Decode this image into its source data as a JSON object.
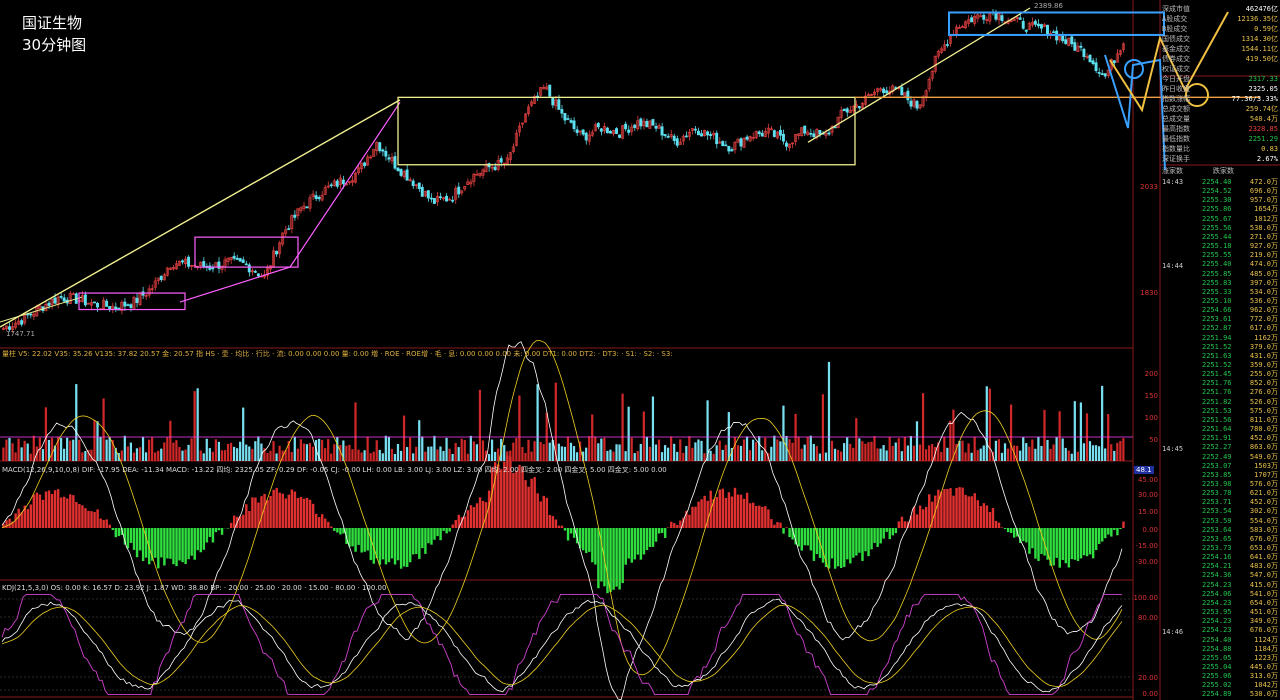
{
  "header": {
    "name": "国证生物",
    "period": "30分钟图"
  },
  "chart_data": [
    {
      "type": "candlestick",
      "title": "国证生物",
      "subtitle": "30分钟图",
      "price_labels": {
        "low": "1747.71",
        "high": "2389.86"
      },
      "axis_ticks": [
        "2033",
        "1830"
      ],
      "close_path": [
        1748,
        1765,
        1790,
        1810,
        1805,
        1795,
        1790,
        1800,
        1830,
        1880,
        1875,
        1870,
        1880,
        1875,
        1850,
        1940,
        1990,
        2020,
        2040,
        2060,
        2120,
        2075,
        2040,
        2000,
        2010,
        2050,
        2070,
        2080,
        2180,
        2230,
        2170,
        2130,
        2150,
        2140,
        2160,
        2150,
        2120,
        2150,
        2130,
        2110,
        2135,
        2140,
        2120,
        2145,
        2130,
        2180,
        2200,
        2230,
        2220,
        2190,
        2290,
        2350,
        2370,
        2380,
        2365,
        2350,
        2345,
        2320,
        2300,
        2250,
        2325
      ],
      "annotations": {
        "key_level": 2210
      }
    },
    {
      "type": "bar",
      "title": "量柱",
      "indicator_text": "量柱 V5: 22.02  V35: 35.26  V135: 37.82  20.57  金: 20.57  指  HS  ·  壶  ·  均比  ·  行比  ·  流: 0.00  0.00  0.00  量: 0.00  増  ·  ROE  ·  ROE增  ·  毛  ·  息: 0.00  0.00  0.00  未: 0.00  DT1: 0.00  DT2:  ·  DT3:  ·  S1:  ·  S2:  ·  S3:",
      "axis_ticks": [
        "200",
        "150",
        "100",
        "50"
      ]
    },
    {
      "type": "bar",
      "title": "MACD",
      "indicator_text": "MACD(12,26,9,10,0,8)  DIF: -17.95  DEA: -11.34  MACD: -13.22  四均: 2325.05  ZF: 0.29  DF: -0.05  CJ: -0.00  LH: 0.00  LB: 3.00  LJ: 3.00  LZ: 3.00  四均: 2.00  四金叉: 2.00  四金叉: 5.00  四金叉: 5.00  0.00",
      "axis_ticks": [
        "45.00",
        "30.00",
        "15.00",
        "0.00",
        "-15.00",
        "-30.00"
      ],
      "marker_value": "48.1"
    },
    {
      "type": "line",
      "title": "KDJ",
      "indicator_text": "KDJ(21,5,3,0)  OS: 0.00  K: 16.57  D: 23.92  J: 1.87  WD: 38.80  BP:  ·  20.00  ·  25.00  ·  20.00  ·  15.00  ·  80.00  ·  100.00",
      "axis_ticks": [
        "100.00",
        "80.00",
        "20.00",
        "0.00"
      ]
    }
  ],
  "side_panel": {
    "stats": [
      {
        "label": "深成市值",
        "value": "462476亿",
        "color": "#ffffff"
      },
      {
        "label": "A股成交",
        "value": "12136.35亿",
        "color": "#e8c14a"
      },
      {
        "label": "B股成交",
        "value": "0.59亿",
        "color": "#e8c14a"
      },
      {
        "label": "国债成交",
        "value": "1314.30亿",
        "color": "#e8c14a"
      },
      {
        "label": "基金成交",
        "value": "1544.11亿",
        "color": "#e8c14a"
      },
      {
        "label": "债券成交",
        "value": "419.50亿",
        "color": "#e8c14a"
      },
      {
        "label": "权证成交",
        "value": "",
        "color": "#e8c14a"
      },
      {
        "label": "今日开盘",
        "value": "2317.33",
        "color": "#22c44b"
      },
      {
        "label": "昨日收盘",
        "value": "2325.05",
        "color": "#ffffff"
      },
      {
        "label": "指数涨幅",
        "value": "77.36/3.33%",
        "color": "#ffffff"
      },
      {
        "label": "总成交额",
        "value": "259.74亿",
        "color": "#e8c14a"
      },
      {
        "label": "总成交量",
        "value": "540.4万",
        "color": "#e8c14a"
      },
      {
        "label": "最高指数",
        "value": "2328.85",
        "color": "#e84040"
      },
      {
        "label": "最低指数",
        "value": "2251.29",
        "color": "#22c44b"
      },
      {
        "label": "指数量比",
        "value": "0.83",
        "color": "#e8c14a"
      },
      {
        "label": "深证换手",
        "value": "2.67%",
        "color": "#ffffff"
      }
    ],
    "columns": {
      "left": "涨家数",
      "right": "跌家数"
    },
    "times": [
      "14:43",
      "14:44",
      "14:45",
      "14:46"
    ],
    "ticks": [
      [
        "2254.40",
        "472.0万"
      ],
      [
        "2254.52",
        "696.0万"
      ],
      [
        "2255.30",
        "957.0万"
      ],
      [
        "2255.86",
        "1654万"
      ],
      [
        "2255.67",
        "1012万"
      ],
      [
        "2255.56",
        "538.0万"
      ],
      [
        "2255.44",
        "271.0万"
      ],
      [
        "2255.18",
        "927.0万"
      ],
      [
        "2255.55",
        "219.0万"
      ],
      [
        "2255.40",
        "474.0万"
      ],
      [
        "2255.85",
        "485.0万"
      ],
      [
        "2255.83",
        "397.0万"
      ],
      [
        "2255.33",
        "534.0万"
      ],
      [
        "2255.10",
        "536.0万"
      ],
      [
        "2254.66",
        "962.0万"
      ],
      [
        "2253.61",
        "772.0万"
      ],
      [
        "2252.87",
        "617.0万"
      ],
      [
        "2251.94",
        "1162万"
      ],
      [
        "2251.52",
        "379.0万"
      ],
      [
        "2251.63",
        "431.0万"
      ],
      [
        "2251.52",
        "359.0万"
      ],
      [
        "2251.45",
        "255.0万"
      ],
      [
        "2251.76",
        "852.0万"
      ],
      [
        "2251.76",
        "276.0万"
      ],
      [
        "2251.82",
        "526.0万"
      ],
      [
        "2251.53",
        "575.0万"
      ],
      [
        "2251.56",
        "811.0万"
      ],
      [
        "2251.64",
        "780.0万"
      ],
      [
        "2251.91",
        "452.0万"
      ],
      [
        "2252.27",
        "863.0万"
      ],
      [
        "2252.49",
        "549.0万"
      ],
      [
        "2253.07",
        "1503万"
      ],
      [
        "2253.85",
        "1707万"
      ],
      [
        "2253.98",
        "576.0万"
      ],
      [
        "2253.78",
        "621.0万"
      ],
      [
        "2253.71",
        "452.0万"
      ],
      [
        "2253.54",
        "302.0万"
      ],
      [
        "2253.59",
        "554.0万"
      ],
      [
        "2253.64",
        "583.0万"
      ],
      [
        "2253.65",
        "676.0万"
      ],
      [
        "2253.73",
        "653.0万"
      ],
      [
        "2254.16",
        "641.0万"
      ],
      [
        "2254.21",
        "483.0万"
      ],
      [
        "2254.36",
        "547.0万"
      ],
      [
        "2254.23",
        "415.0万"
      ],
      [
        "2254.06",
        "541.0万"
      ],
      [
        "2254.23",
        "654.0万"
      ],
      [
        "2253.95",
        "451.0万"
      ],
      [
        "2254.23",
        "349.0万"
      ],
      [
        "2254.23",
        "676.0万"
      ],
      [
        "2254.40",
        "1124万"
      ],
      [
        "2254.88",
        "1184万"
      ],
      [
        "2255.05",
        "1223万"
      ],
      [
        "2255.04",
        "445.0万"
      ],
      [
        "2255.06",
        "313.0万"
      ],
      [
        "2255.02",
        "1042万"
      ],
      [
        "2254.89",
        "530.0万"
      ]
    ]
  }
}
